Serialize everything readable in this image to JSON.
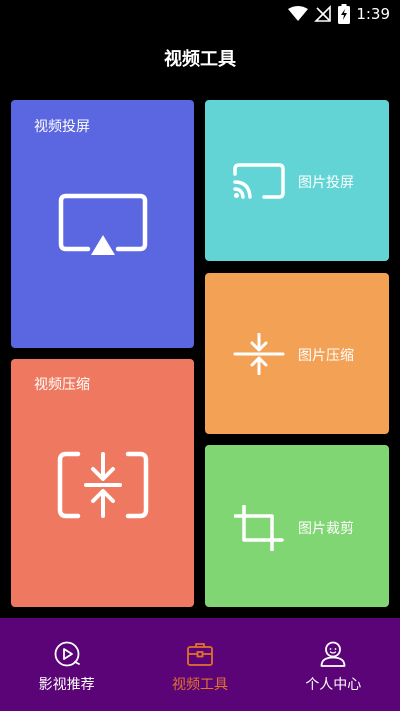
{
  "status_bar": {
    "time": "1:39"
  },
  "header": {
    "title": "视频工具"
  },
  "cards": {
    "video_cast": {
      "label": "视频投屏",
      "color": "#5b67e0"
    },
    "video_compress": {
      "label": "视频压缩",
      "color": "#ef7960"
    },
    "image_cast": {
      "label": "图片投屏",
      "color": "#62d4d6"
    },
    "image_compress": {
      "label": "图片压缩",
      "color": "#f2a155"
    },
    "image_crop": {
      "label": "图片裁剪",
      "color": "#80d673"
    }
  },
  "bottom_nav": {
    "items": [
      {
        "label": "影视推荐",
        "icon": "play-circle-icon",
        "active": false
      },
      {
        "label": "视频工具",
        "icon": "toolbox-icon",
        "active": true
      },
      {
        "label": "个人中心",
        "icon": "person-icon",
        "active": false
      }
    ],
    "background": "#5b0478",
    "active_color": "#e2722c"
  }
}
